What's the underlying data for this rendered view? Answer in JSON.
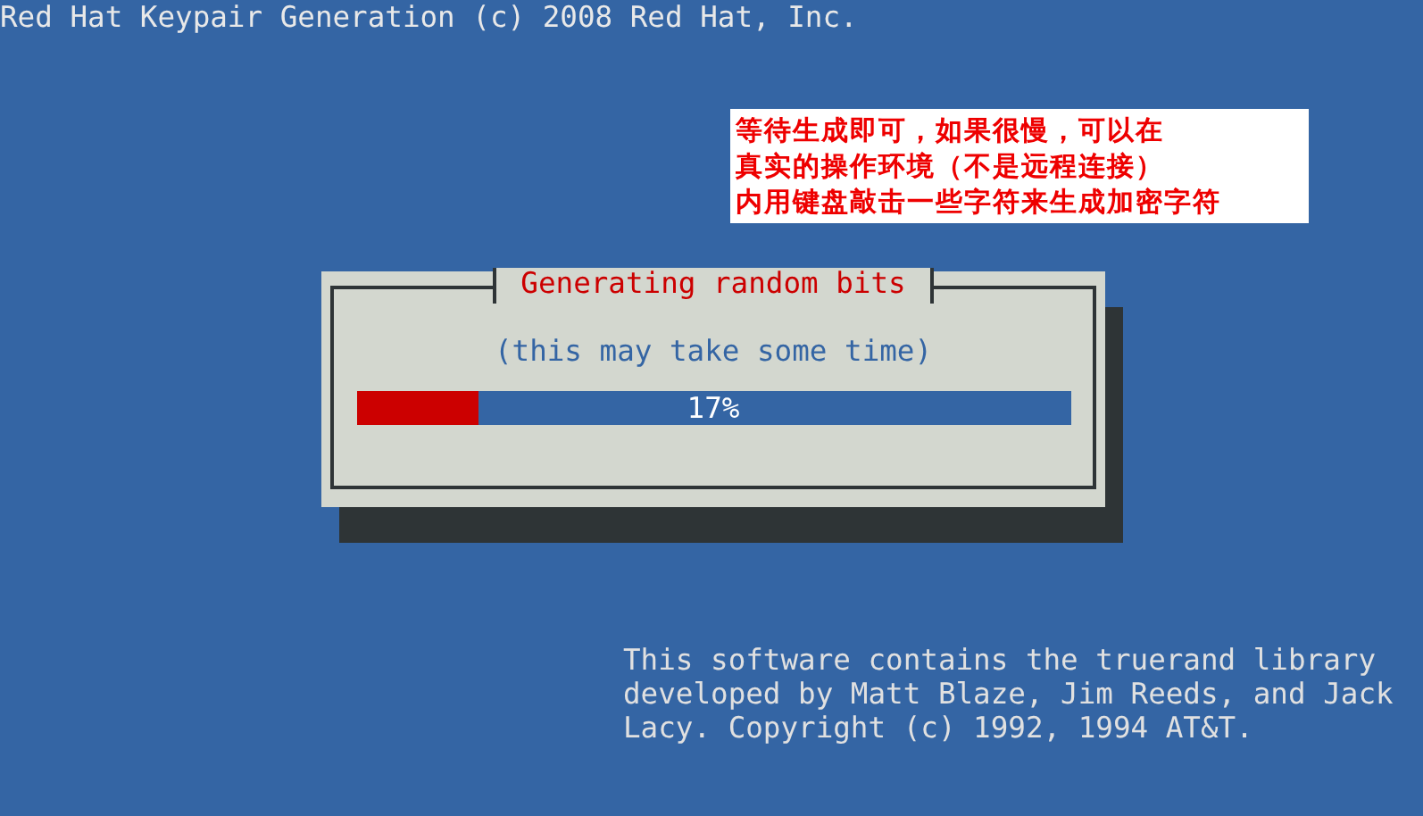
{
  "window": {
    "title": "Red Hat Keypair Generation (c) 2008 Red Hat, Inc."
  },
  "annotation": {
    "lines": [
      "等待生成即可，如果很慢，可以在",
      "真实的操作环境（不是远程连接）",
      "内用键盘敲击一些字符来生成加密字符"
    ]
  },
  "dialog": {
    "title": "Generating random bits",
    "message": "(this may take some time)",
    "progress": {
      "level": 0.17,
      "reading": "17%"
    }
  },
  "footer": {
    "lines": [
      "This software contains the truerand library",
      "developed by Matt Blaze, Jim Reeds, and Jack",
      "Lacy. Copyright (c) 1992, 1994 AT&T."
    ]
  }
}
